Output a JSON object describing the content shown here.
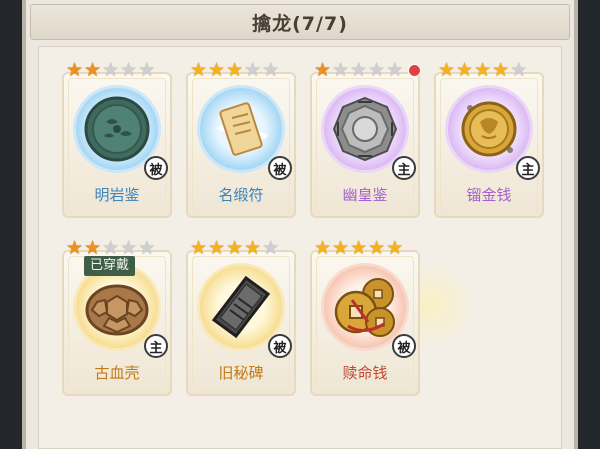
{
  "title": "擒龙(7/7)",
  "colors": {
    "star_on": "#f5b21a",
    "star_off": "#cfcfcf",
    "equipped_bg": "#3f5e47",
    "notification_dot": "#e44040"
  },
  "items": [
    {
      "name": "明岩鉴",
      "stars": 2,
      "max_stars": 5,
      "badge": "被",
      "rarity": "blue",
      "icon": "jade-mirror-icon"
    },
    {
      "name": "名缎符",
      "stars": 3,
      "max_stars": 5,
      "badge": "被",
      "rarity": "blue",
      "icon": "scroll-talisman-icon"
    },
    {
      "name": "幽皇鉴",
      "stars": 1,
      "max_stars": 5,
      "badge": "主",
      "rarity": "purple",
      "icon": "bagua-mirror-icon",
      "has_notification": true
    },
    {
      "name": "镏金钱",
      "stars": 4,
      "max_stars": 5,
      "badge": "主",
      "rarity": "purple",
      "icon": "gold-coin-icon"
    },
    {
      "name": "古血壳",
      "stars": 2,
      "max_stars": 5,
      "badge": "主",
      "rarity": "gold",
      "icon": "turtle-shell-icon",
      "status": "已穿戴"
    },
    {
      "name": "旧秘碑",
      "stars": 4,
      "max_stars": 5,
      "badge": "被",
      "rarity": "gold",
      "icon": "stone-tablet-icon"
    },
    {
      "name": "赎命钱",
      "stars": 5,
      "max_stars": 5,
      "badge": "被",
      "rarity": "red",
      "icon": "red-coins-icon"
    }
  ]
}
